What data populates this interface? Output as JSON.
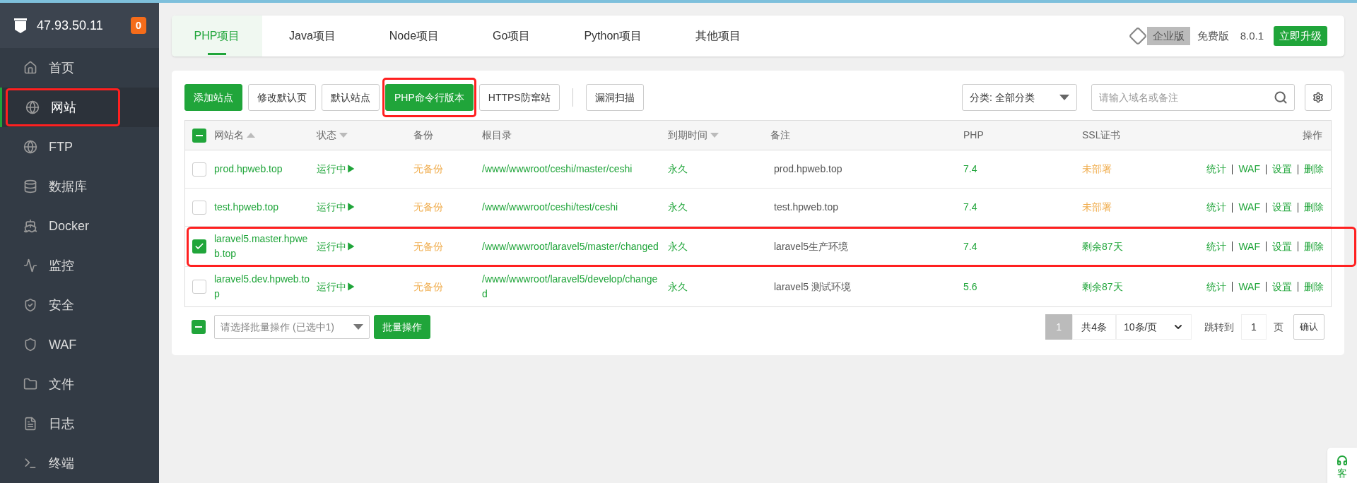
{
  "sidebar": {
    "server": "47.93.50.11",
    "badge": "0",
    "items": [
      {
        "label": "首页",
        "selected": false
      },
      {
        "label": "网站",
        "selected": true,
        "annotated": true
      },
      {
        "label": "FTP",
        "selected": false
      },
      {
        "label": "数据库",
        "selected": false
      },
      {
        "label": "Docker",
        "selected": false
      },
      {
        "label": "监控",
        "selected": false
      },
      {
        "label": "安全",
        "selected": false
      },
      {
        "label": "WAF",
        "selected": false
      },
      {
        "label": "文件",
        "selected": false
      },
      {
        "label": "日志",
        "selected": false
      },
      {
        "label": "终端",
        "selected": false
      }
    ]
  },
  "tabs": [
    {
      "label": "PHP项目",
      "selected": true
    },
    {
      "label": "Java项目",
      "selected": false
    },
    {
      "label": "Node项目",
      "selected": false
    },
    {
      "label": "Go项目",
      "selected": false
    },
    {
      "label": "Python项目",
      "selected": false
    },
    {
      "label": "其他项目",
      "selected": false
    }
  ],
  "edition": {
    "enterprise": "企业版",
    "free": "免费版",
    "version": "8.0.1",
    "upgrade": "立即升级"
  },
  "toolbar": {
    "buttons": [
      {
        "label": "添加站点",
        "kind": "primary"
      },
      {
        "label": "修改默认页",
        "kind": "default"
      },
      {
        "label": "默认站点",
        "kind": "default"
      },
      {
        "label": "PHP命令行版本",
        "kind": "primary",
        "annotated": true
      },
      {
        "label": "HTTPS防窜站",
        "kind": "default"
      },
      {
        "label": "漏洞扫描",
        "kind": "default"
      }
    ],
    "category": "分类: 全部分类",
    "search_placeholder": "请输入域名或备注"
  },
  "table": {
    "header_partial": true,
    "columns": [
      {
        "label": "网站名",
        "sortable": true,
        "ascending": true
      },
      {
        "label": "状态",
        "sortable": true,
        "ascending": false
      },
      {
        "label": "备份",
        "sortable": false
      },
      {
        "label": "根目录",
        "sortable": false
      },
      {
        "label": "到期时间",
        "sortable": true,
        "ascending": false
      },
      {
        "label": "备注",
        "sortable": false
      },
      {
        "label": "PHP",
        "sortable": false
      },
      {
        "label": "SSL证书",
        "sortable": false
      },
      {
        "label": "操作",
        "sortable": false
      }
    ],
    "rows": [
      {
        "checked": false,
        "name": "prod.hpweb.top",
        "status": "运行中▶",
        "backup": "无备份",
        "root": "/www/wwwroot/ceshi/master/ceshi",
        "expiry": "永久",
        "note": "prod.hpweb.top",
        "php": "7.4",
        "ssl": "未部署",
        "ssl_ok": false,
        "actions": [
          "统计",
          "WAF",
          "设置",
          "删除"
        ]
      },
      {
        "checked": false,
        "name": "test.hpweb.top",
        "status": "运行中▶",
        "backup": "无备份",
        "root": "/www/wwwroot/ceshi/test/ceshi",
        "expiry": "永久",
        "note": "test.hpweb.top",
        "php": "7.4",
        "ssl": "未部署",
        "ssl_ok": false,
        "actions": [
          "统计",
          "WAF",
          "设置",
          "删除"
        ]
      },
      {
        "checked": true,
        "annotated": true,
        "name": "laravel5.master.hpweb.top",
        "status": "运行中▶",
        "backup": "无备份",
        "root": "/www/wwwroot/laravel5/master/changed",
        "expiry": "永久",
        "note": "laravel5生产环境",
        "php": "7.4",
        "ssl": "剩余87天",
        "ssl_ok": true,
        "actions": [
          "统计",
          "WAF",
          "设置",
          "删除"
        ]
      },
      {
        "checked": false,
        "name": "laravel5.dev.hpweb.top",
        "status": "运行中▶",
        "backup": "无备份",
        "root": "/www/wwwroot/laravel5/develop/changed",
        "expiry": "永久",
        "note": "laravel5 测试环境",
        "php": "5.6",
        "ssl": "剩余87天",
        "ssl_ok": true,
        "actions": [
          "统计",
          "WAF",
          "设置",
          "删除"
        ]
      }
    ]
  },
  "footer": {
    "select_all_partial": true,
    "batch_placeholder": "请选择批量操作 (已选中1)",
    "batch_button": "批量操作",
    "page": "1",
    "total": "共4条",
    "per_page": "10条/页",
    "jump_label": "跳转到",
    "jump_value": "1",
    "page_unit": "页",
    "confirm": "确认"
  },
  "service_widget": {
    "label": "客"
  }
}
